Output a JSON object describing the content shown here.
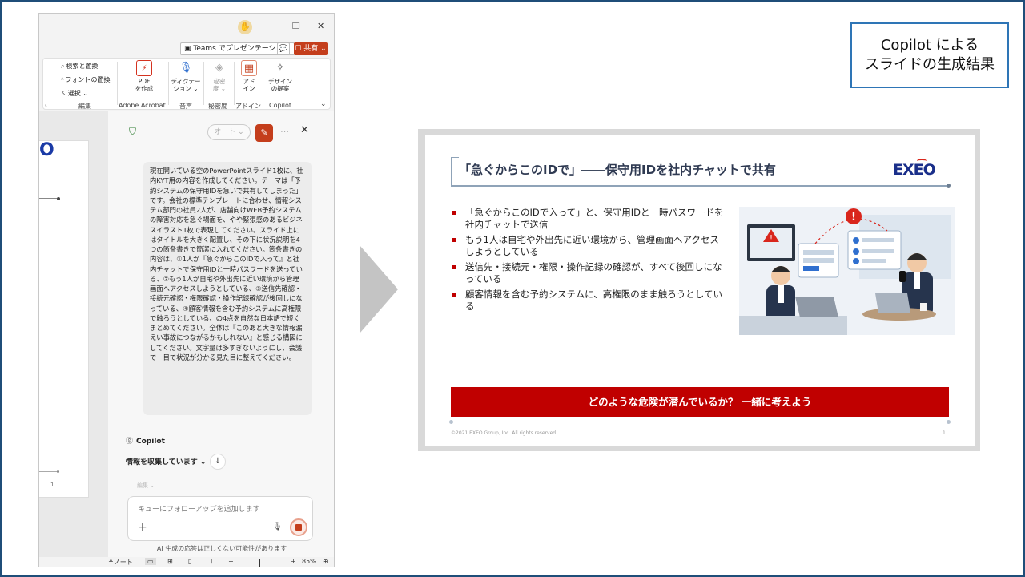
{
  "ppt": {
    "title_buttons": {
      "minimize": "−",
      "restore": "❐",
      "close": "✕"
    },
    "teams_label": "Teams でプレゼンテーション",
    "share_label": "共有",
    "ribbon": {
      "search_replace": "検索と置換",
      "font_replace": "フォントの置換",
      "select": "選択",
      "edit_group": "編集",
      "pdf_line1": "PDF",
      "pdf_line2": "を作成",
      "adobe_group": "Adobe Acrobat",
      "dictate_line1": "ディクテー",
      "dictate_line2": "ション",
      "voice_group": "音声",
      "sensitivity_line1": "秘密",
      "sensitivity_line2": "度",
      "sensitivity_group": "秘密度",
      "addin_line1": "アド",
      "addin_line2": "イン",
      "addin_group": "アドイン",
      "designer_line1": "デザイン",
      "designer_line2": "の提案",
      "copilot_group": "Copilot"
    },
    "copilot_pane": {
      "mode": "オート",
      "prompt": "現在開いている空のPowerPointスライド1枚に、社内KYT用の内容を作成してください。テーマは「予約システムの保守用IDを急いで共有してしまった」です。会社の標準テンプレートに合わせ、情報システム部門の社員2人が、店舗向けWEB予約システムの障害対応を急ぐ場面を、やや緊張感のあるビジネスイラスト1枚で表現してください。スライド上にはタイトルを大きく配置し、その下に状況説明を4つの箇条書きで簡潔に入れてください。箇条書きの内容は、①1人が『急ぐからこのIDで入って』と社内チャットで保守用IDと一時パスワードを送っている、②もう1人が自宅や外出先に近い環境から管理画面へアクセスしようとしている、③送信先確認・接続元確認・権限確認・操作記録確認が後回しになっている、④顧客情報を含む予約システムに高権限で触ろうとしている、の4点を自然な日本語で短くまとめてください。全体は『このあと大きな情報漏えい事故につながるかもしれない』と感じる構図にしてください。文字量は多すぎないようにし、会議で一目で状況が分かる見た目に整えてください。",
      "copilot_label": "Copilot",
      "collecting": "情報を収集しています",
      "edit_faded": "編集",
      "input_placeholder": "キューにフォローアップを追加します",
      "disclaimer": "AI 生成の応答は正しくない可能性があります"
    },
    "statusbar": {
      "notes": "ノート",
      "zoom_minus": "−",
      "zoom_plus": "+",
      "zoom_level": "85%"
    },
    "thumbnail_page": "1"
  },
  "caption": {
    "line1": "Copilot による",
    "line2": "スライドの生成結果"
  },
  "slide": {
    "title": "「急ぐからこのIDで」――保守用IDを社内チャットで共有",
    "logo": "EXEO",
    "bullets": [
      "「急ぐからこのIDで入って」と、保守用IDと一時パスワードを社内チャットで送信",
      "もう1人は自宅や外出先に近い環境から、管理画面へアクセスしようとしている",
      "送信先・接続元・権限・操作記録の確認が、すべて後回しになっている",
      "顧客情報を含む予約システムに、高権限のまま触ろうとしている"
    ],
    "banner": "どのような危険が潜んでいるか？ 一緒に考えよう",
    "copyright": "©2021 EXEO Group, Inc. All rights reserved",
    "page_number": "1"
  },
  "colors": {
    "accent_red": "#c00000",
    "ppt_orange": "#c43e1c",
    "frame_blue": "#1f4e79",
    "logo_blue": "#1a2f8a"
  }
}
